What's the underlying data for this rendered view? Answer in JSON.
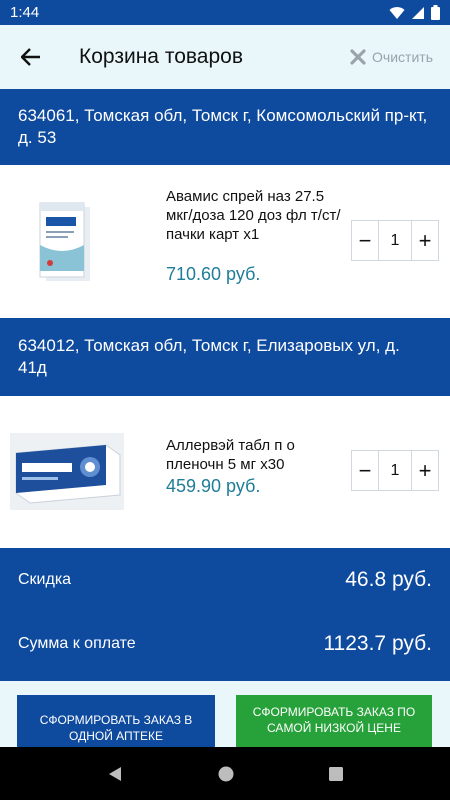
{
  "status": {
    "time": "1:44"
  },
  "header": {
    "title": "Корзина товаров",
    "clear_label": "Очистить"
  },
  "groups": [
    {
      "address": "634061, Томская обл, Томск г, Комсомольский пр-кт, д. 53",
      "item": {
        "name": "Авамис спрей наз 27.5 мкг/доза 120 доз фл т/ст/пачки карт x1",
        "price": "710.60 руб.",
        "quantity": "1"
      }
    },
    {
      "address": "634012, Томская обл, Томск г, Елизаровых ул, д. 41д",
      "item": {
        "name": "Аллервэй табл п о пленочн 5 мг x30",
        "price": "459.90 руб.",
        "quantity": "1"
      }
    }
  ],
  "summary": {
    "discount_label": "Скидка",
    "discount_value": "46.8 руб.",
    "total_label": "Сумма к оплате",
    "total_value": "1123.7 руб."
  },
  "actions": {
    "one_pharmacy": "СФОРМИРОВАТЬ ЗАКАЗ В ОДНОЙ АПТЕКЕ",
    "lowest_price": "СФОРМИРОВАТЬ ЗАКАЗ ПО САМОЙ НИЗКОЙ ЦЕНЕ"
  },
  "stepper": {
    "minus": "−",
    "plus": "+"
  },
  "colors": {
    "primary": "#0e4a9e",
    "appbar": "#e9f7fb",
    "price": "#1f7d99",
    "accent_green": "#27a23a"
  },
  "icons": [
    "wifi-icon",
    "signal-icon",
    "battery-icon",
    "back-arrow-icon",
    "clear-x-icon",
    "nav-back-icon",
    "nav-home-icon",
    "nav-recents-icon"
  ]
}
